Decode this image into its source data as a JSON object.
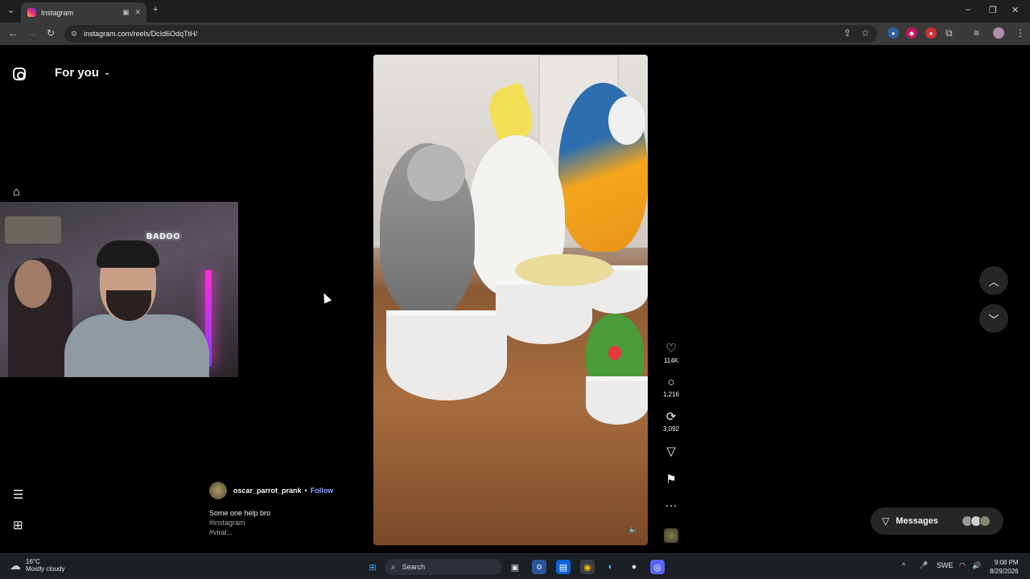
{
  "browser": {
    "tab_title": "Instagram",
    "url": "instagram.com/reels/DcId6OdqTtH/"
  },
  "page": {
    "header_title": "For you"
  },
  "reel": {
    "username": "oscar_parrot_prank",
    "separator": "•",
    "follow_label": "Follow",
    "caption": "Some one help bro",
    "hashtag1": "#instagram",
    "hashtag2": "#viral...",
    "likes": "114K",
    "comments": "1,216",
    "reposts": "3,092"
  },
  "webcam": {
    "neon_sign": "BADOO"
  },
  "messages": {
    "label": "Messages"
  },
  "taskbar": {
    "temperature": "16°C",
    "weather": "Mostly cloudy",
    "search_placeholder": "Search",
    "language": "SWE",
    "time": "9:08 PM",
    "date": "8/29/2026"
  },
  "icons": {
    "instagram": "instagram-logo-icon",
    "home": "home-icon",
    "menu": "hamburger-menu-icon",
    "more_apps": "grid-icon",
    "like": "heart-icon",
    "comment": "comment-icon",
    "repost": "repost-icon",
    "share": "send-icon",
    "save": "bookmark-icon",
    "more": "more-icon",
    "mute": "mute-icon"
  }
}
